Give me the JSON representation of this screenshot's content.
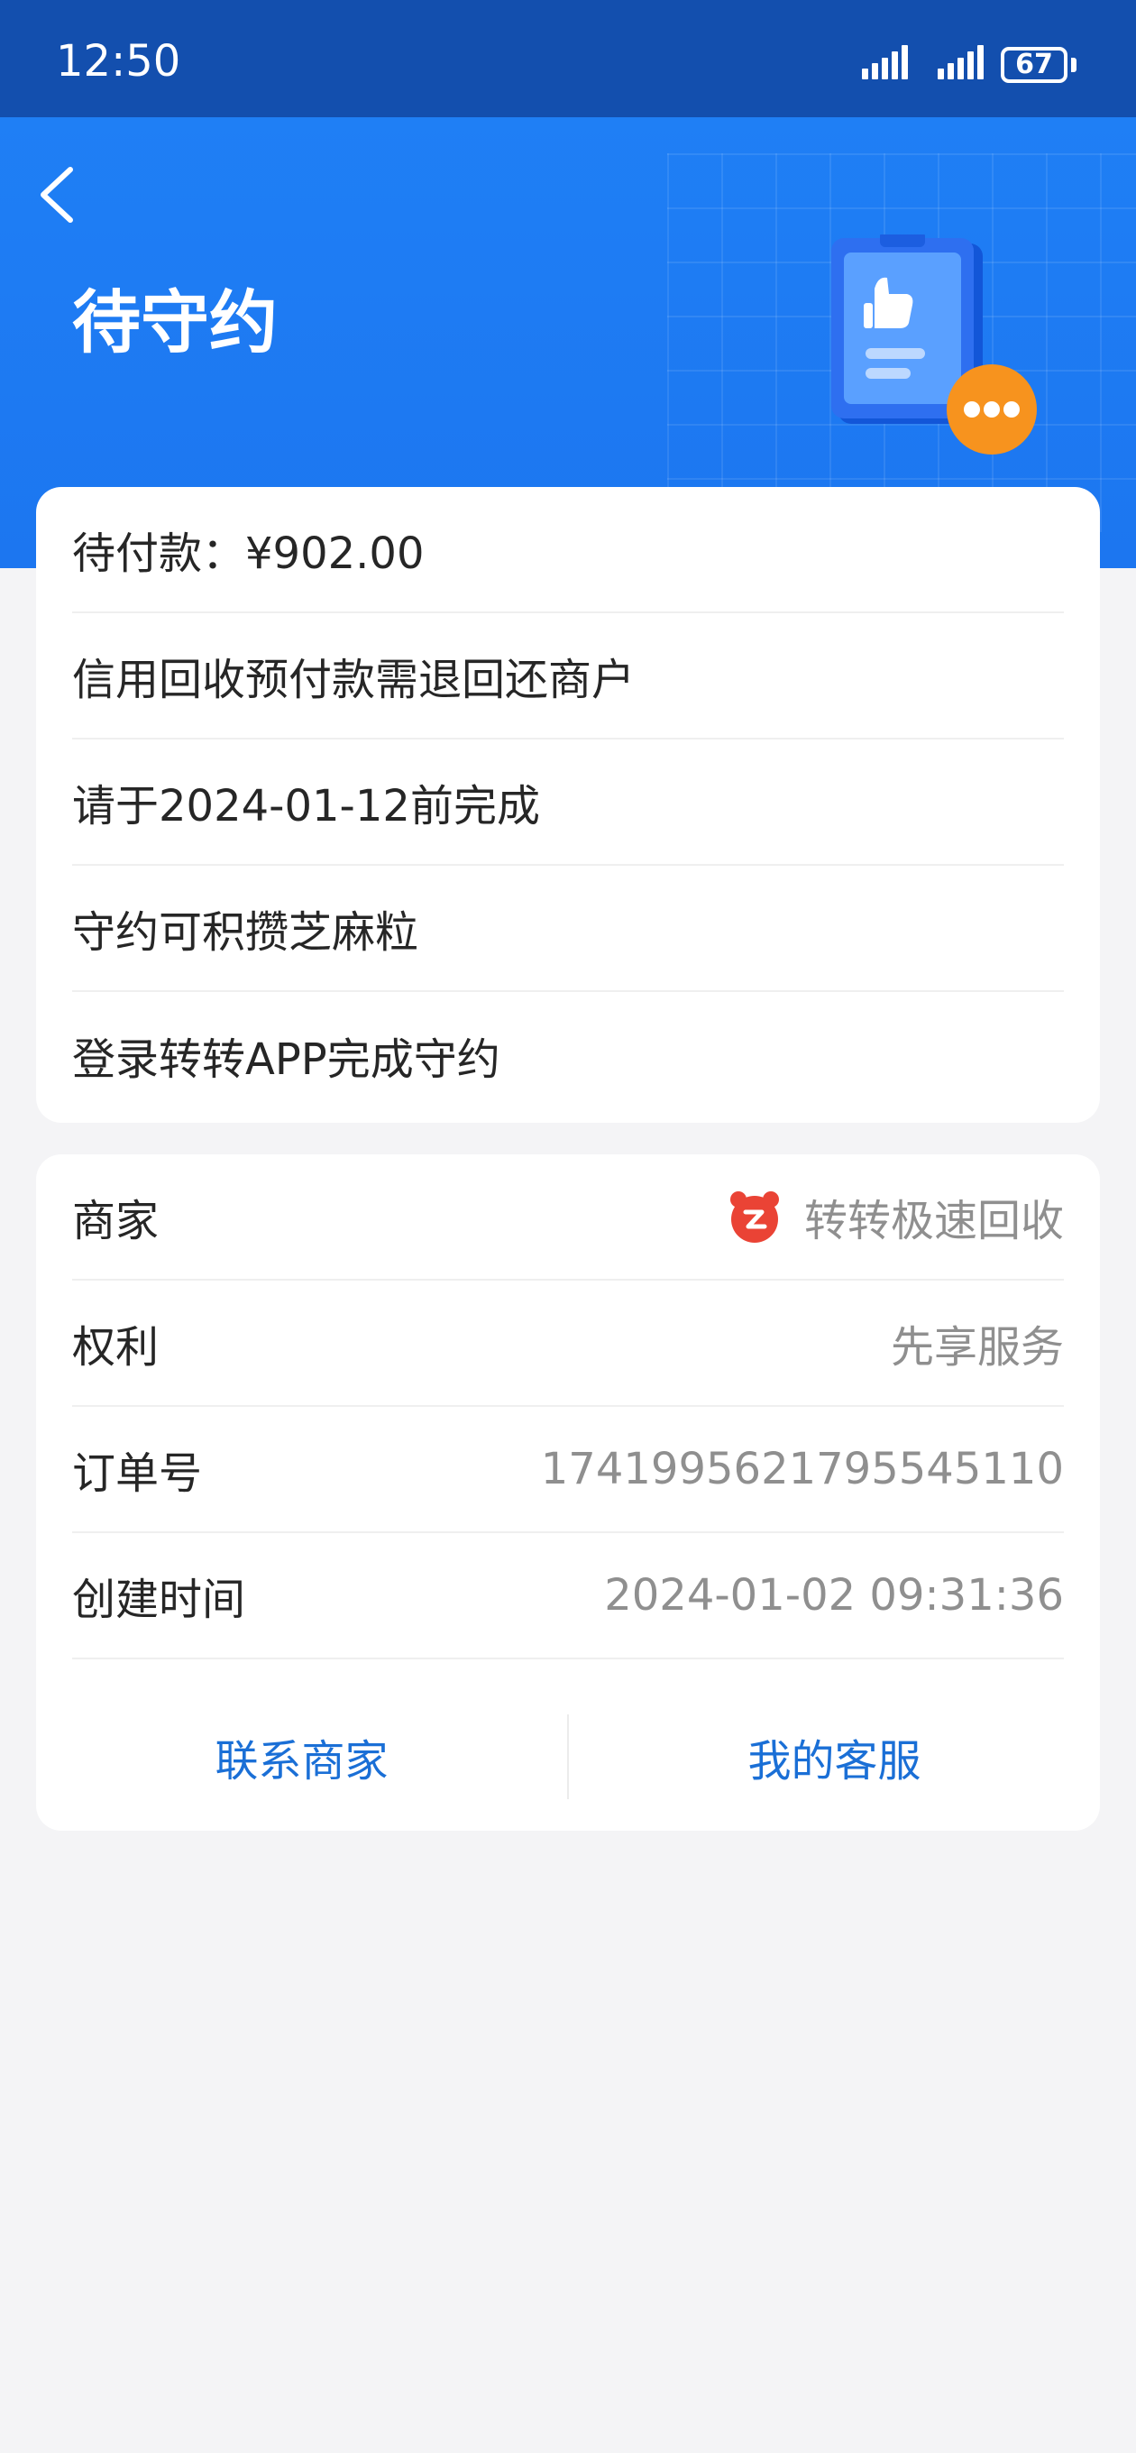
{
  "status_bar": {
    "time": "12:50",
    "battery": "67"
  },
  "header": {
    "title": "待守约"
  },
  "notice_card": {
    "items": [
      "待付款：¥902.00",
      "信用回收预付款需退回还商户",
      "请于2024-01-12前完成",
      "守约可积攒芝麻粒",
      "登录转转APP完成守约"
    ]
  },
  "info_card": {
    "rows": [
      {
        "label": "商家",
        "value": "转转极速回收"
      },
      {
        "label": "权利",
        "value": "先享服务"
      },
      {
        "label": "订单号",
        "value": "1741995621795545110"
      },
      {
        "label": "创建时间",
        "value": "2024-01-02 09:31:36"
      }
    ],
    "contact_merchant": "联系商家",
    "my_service": "我的客服"
  },
  "icons": {
    "back": "chevron-left-icon",
    "merchant_logo": "zhuanzhuan-logo-icon",
    "signal": "signal-icon",
    "battery": "battery-icon"
  },
  "colors": {
    "status_bar": "#134fae",
    "header": "#1f7ff5",
    "link": "#1a6fd6",
    "accent_orange": "#f7931e",
    "logo_red": "#ea4335"
  }
}
